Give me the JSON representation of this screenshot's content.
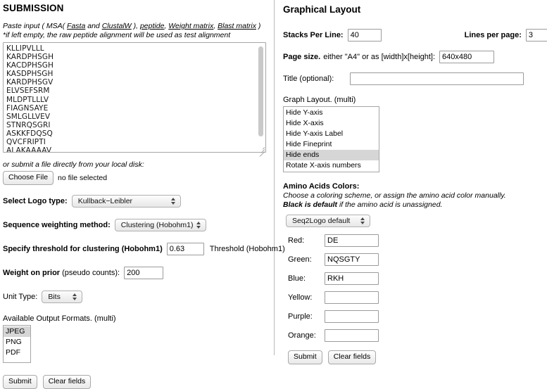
{
  "left": {
    "title": "SUBMISSION",
    "paste": {
      "prefix": "Paste input ( MSA(",
      "link_fasta": "Fasta",
      "mid_and": "and",
      "link_clustalw": "ClustalW",
      "after_msa": "),",
      "link_peptide": "peptide",
      "comma1": ",",
      "link_weight_matrix": "Weight matrix",
      "comma2": ",",
      "link_blast_matrix": "Blast matrix",
      "suffix": ")"
    },
    "note": "*if left empty, the raw peptide alignment will be used as test alignment",
    "sequences": "KLLIPVLLL\nKARDPHSGH\nKACDPHSGH\nKASDPHSGH\nKARDPHSGV\nELVSEFSRM\nMLDPTLLLV\nFIAGNSAYE\nSMLGLLVEV\nSTNRQSGRI\nASKKFDQSQ\nQVCFRIPTI\nALAKAAAAV",
    "file_label": "or submit a file directly from your local disk:",
    "choose_file_button": "Choose File",
    "file_status": "no file selected",
    "logo_type_label": "Select Logo type:",
    "logo_type_value": "Kullback−Leibler",
    "weighting_label": "Sequence weighting method:",
    "weighting_value": "Clustering (Hobohm1)",
    "threshold_label": "Specify threshold for clustering (Hobohm1)",
    "threshold_value": "0.63",
    "threshold_after": "Threshold (Hobohm1)",
    "weight_prior_bold": "Weight on prior",
    "weight_prior_rest": "(pseudo counts):",
    "weight_prior_value": "200",
    "unit_type_label": "Unit Type:",
    "unit_type_value": "Bits",
    "formats_label": "Available Output Formats. (multi)",
    "formats": [
      {
        "label": "JPEG",
        "selected": true
      },
      {
        "label": "PNG",
        "selected": false
      },
      {
        "label": "PDF",
        "selected": false
      }
    ],
    "submit_button": "Submit",
    "clear_button": "Clear fields"
  },
  "right": {
    "title": "Graphical Layout",
    "stacks_label": "Stacks Per Line:",
    "stacks_value": "40",
    "lines_label": "Lines per page:",
    "lines_value": "3",
    "page_size_bold": "Page size.",
    "page_size_rest": "either \"A4\" or as [width]x[height]:",
    "page_size_value": "640x480",
    "title_label": "Title (optional):",
    "title_value": "",
    "graph_layout_label": "Graph Layout. (multi)",
    "graph_layout_options": [
      {
        "label": "Hide Y-axis",
        "selected": false
      },
      {
        "label": "Hide X-axis",
        "selected": false
      },
      {
        "label": "Hide Y-axis Label",
        "selected": false
      },
      {
        "label": "Hide Fineprint",
        "selected": false
      },
      {
        "label": "Hide ends",
        "selected": true
      },
      {
        "label": "Rotate X-axis numbers",
        "selected": false
      }
    ],
    "aa_title": "Amino Acids Colors:",
    "aa_desc_line1": "Choose a coloring scheme, or assign the amino acid color manually.",
    "aa_desc_bold": "Black is default",
    "aa_desc_line2_rest": " if the amino acid is unassigned.",
    "scheme_value": "Seq2Logo default",
    "colors": [
      {
        "label": "Red:",
        "value": "DE"
      },
      {
        "label": "Green:",
        "value": "NQSGTY"
      },
      {
        "label": "Blue:",
        "value": "RKH"
      },
      {
        "label": "Yellow:",
        "value": ""
      },
      {
        "label": "Purple:",
        "value": ""
      },
      {
        "label": "Orange:",
        "value": ""
      }
    ],
    "submit_button": "Submit",
    "clear_button": "Clear fields"
  }
}
